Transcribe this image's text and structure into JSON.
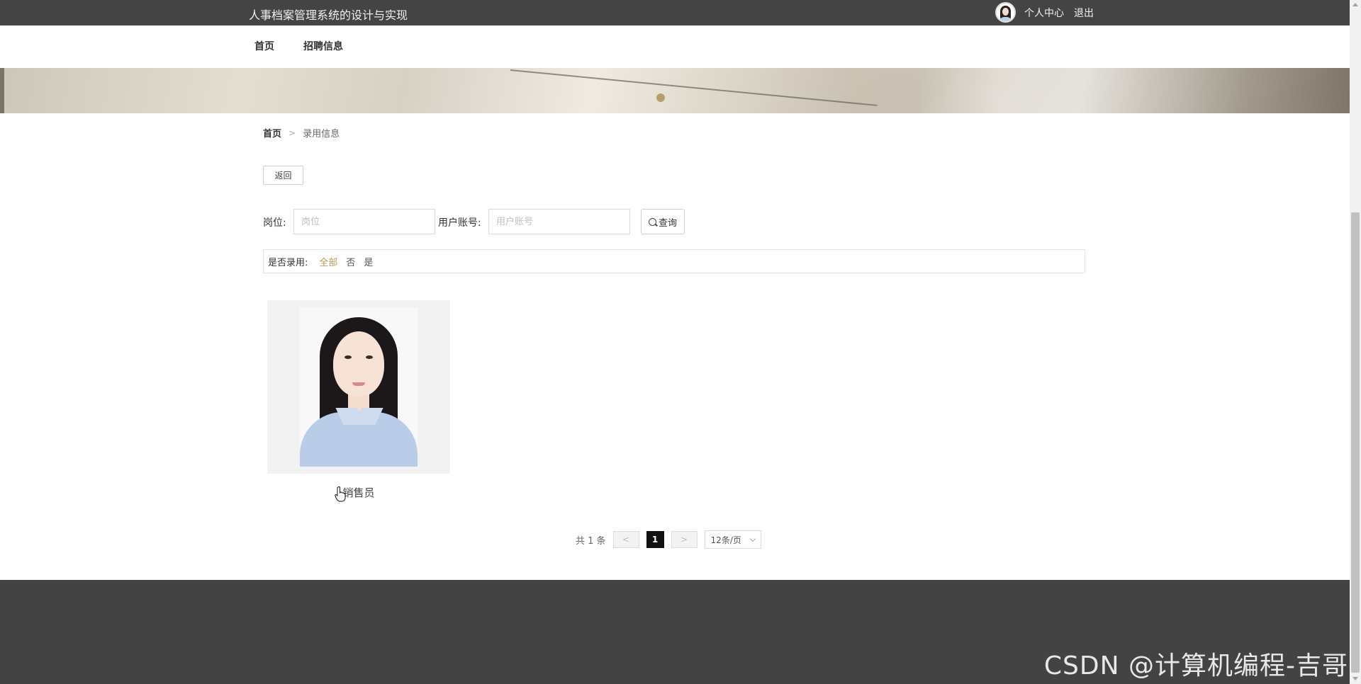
{
  "header": {
    "site_title": "人事档案管理系统的设计与实现",
    "user_center": "个人中心",
    "logout": "退出"
  },
  "nav": {
    "items": [
      {
        "label": "首页"
      },
      {
        "label": "招聘信息"
      }
    ]
  },
  "banner": {
    "active_slide": 1
  },
  "breadcrumb": {
    "home": "首页",
    "separator": ">",
    "current": "录用信息"
  },
  "back_button": "返回",
  "search": {
    "position_label": "岗位:",
    "position_placeholder": "岗位",
    "account_label": "用户账号:",
    "account_placeholder": "用户账号",
    "button_label": "查询"
  },
  "filter": {
    "title": "是否录用:",
    "options": [
      {
        "label": "全部",
        "active": true
      },
      {
        "label": "否",
        "active": false
      },
      {
        "label": "是",
        "active": false
      }
    ]
  },
  "cards": [
    {
      "title": "销售员"
    }
  ],
  "pagination": {
    "total": "共 1 条",
    "prev": "<",
    "current": "1",
    "next": ">",
    "page_size": "12条/页"
  },
  "watermark": "CSDN @计算机编程-吉哥",
  "colors": {
    "topbar": "#444444",
    "accent": "#b89a58",
    "footer": "#434343"
  }
}
